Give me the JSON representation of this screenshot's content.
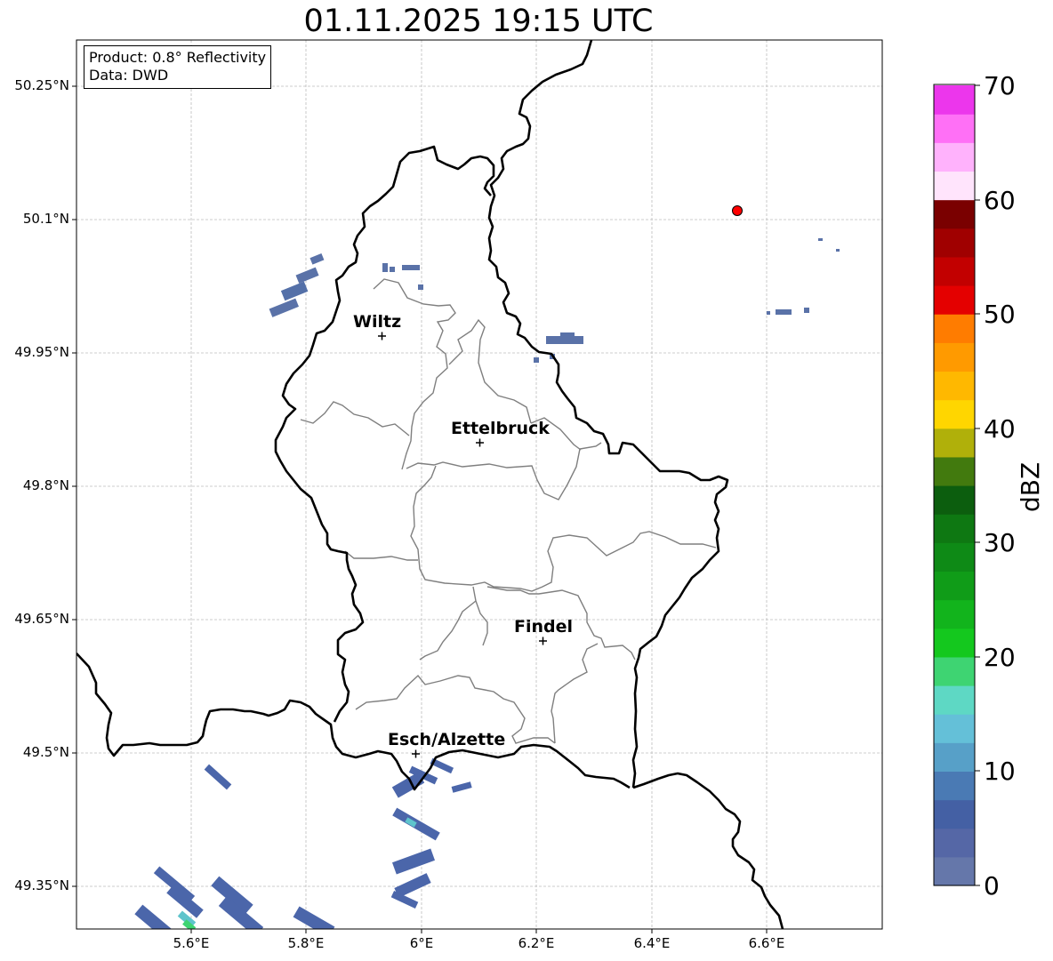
{
  "title": "01.11.2025 19:15 UTC",
  "info": {
    "product": "Product: 0.8° Reflectivity",
    "data": "Data: DWD"
  },
  "latitude_labels": [
    "50.25°N",
    "50.1°N",
    "49.95°N",
    "49.8°N",
    "49.65°N",
    "49.5°N",
    "49.35°N"
  ],
  "longitude_labels": [
    "5.6°E",
    "5.8°E",
    "6°E",
    "6.2°E",
    "6.4°E",
    "6.6°E"
  ],
  "map_extent": {
    "lon": [
      5.4,
      6.8
    ],
    "lat": [
      49.3,
      50.35
    ]
  },
  "cities": [
    {
      "name": "Wiltz",
      "lon": 5.935,
      "lat": 49.966
    },
    {
      "name": "Ettelbruck",
      "lon": 6.1,
      "lat": 49.85
    },
    {
      "name": "Findel",
      "lon": 6.21,
      "lat": 49.627
    },
    {
      "name": "Esch/Alzette",
      "lon": 5.99,
      "lat": 49.5
    }
  ],
  "radar_site": {
    "lon": 6.548,
    "lat": 50.11,
    "color": "#ff0000"
  },
  "colorbar": {
    "label": "dBZ",
    "ticks": [
      "70",
      "60",
      "50",
      "40",
      "30",
      "20",
      "10",
      "0"
    ],
    "min": 0,
    "max": 70,
    "step": 2.5,
    "colors": [
      "#6577aa",
      "#5567a6",
      "#4460a4",
      "#4a7ab4",
      "#57a0c8",
      "#64c0d8",
      "#5ed8c4",
      "#3ed472",
      "#14c81e",
      "#12b41c",
      "#109c18",
      "#0e8a16",
      "#0e7812",
      "#0c5e0e",
      "#427a0e",
      "#b0b00a",
      "#ffd600",
      "#ffb800",
      "#ff9a00",
      "#ff7c00",
      "#e40000",
      "#c20000",
      "#a00000",
      "#7a0000",
      "#ffe4fc",
      "#ffb2fc",
      "#ff70f6",
      "#ec36ec"
    ]
  }
}
